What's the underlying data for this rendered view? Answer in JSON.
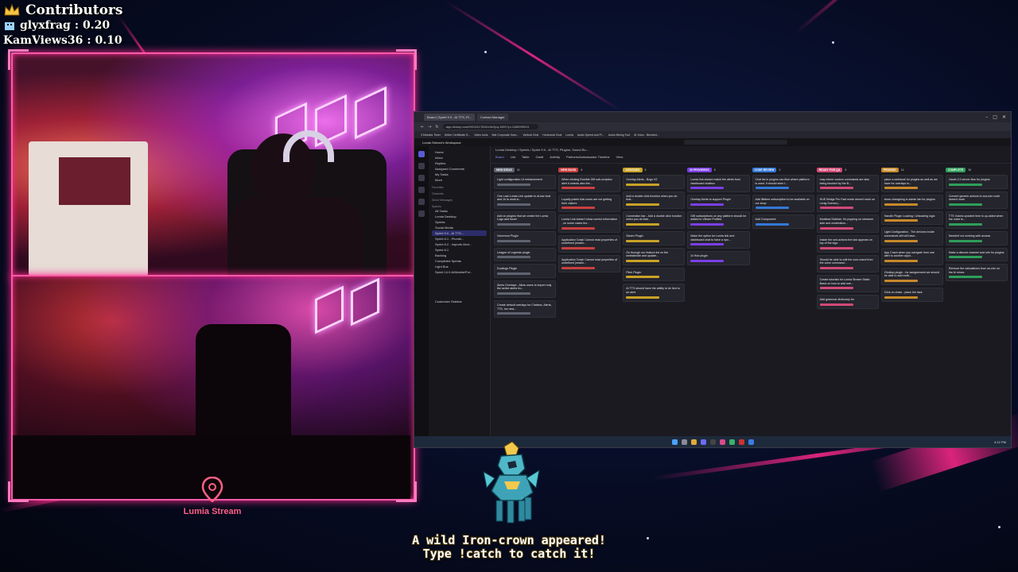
{
  "contributors": {
    "title": "Contributors",
    "entries": [
      {
        "name": "glyxfrag",
        "value": "0.20"
      },
      {
        "name": "KamViews36",
        "value": "0.10"
      }
    ]
  },
  "logo": {
    "name": "Lumia Stream"
  },
  "catch_message": {
    "line1": "A wild Iron-crown appeared!",
    "line2": "Type !catch to catch it!"
  },
  "screen_share": {
    "browser_tabs": [
      "Board | Sprint 9.0 - AI TTS, Pl...",
      "Contact Manager"
    ],
    "url": "app.clickup.com/9012417816/v/b/2pq-1801?p=1188939011",
    "bookmarks": [
      "3 Minutes Timer",
      "Dirtier Certificate S...",
      "Video tools",
      "Mat Corporate Gam...",
      "Vertical Chat",
      "Horizontal Chat",
      "Lumia",
      "Audio Speed and Pi...",
      "Audio Mixing Tool",
      "AI Voice - Blended..."
    ],
    "workspace": "Lumia Stream's Workspace",
    "breadcrumb": "Lumia Desktop / Sprints / Sprint 9.0 - AI TTS, Plugins, Sound Bo...",
    "views": [
      "Board",
      "List",
      "Table",
      "Gantt",
      "Activity",
      "Partners/Ambassador Timeline",
      "View"
    ],
    "sidebar": {
      "items": [
        "Home",
        "Inbox",
        "Replies",
        "Assigned Comments",
        "My Tasks",
        "More"
      ],
      "sections": [
        "Favorites",
        "Channels",
        "Direct Messages",
        "Spaces"
      ],
      "spaces": [
        "All Tasks",
        "Lumia Desktop",
        "Sprints",
        "Social Media",
        "Sprint 9.0 - AI TTS...",
        "Sprint 8.1 - Plumbi...",
        "Sprint 8.2 - Imports Mod...",
        "Sprint 8.1",
        "Backlog",
        "Completed Sprints",
        "Light Bus",
        "Sprint 14.0 AI/Mobile/Pol..."
      ],
      "customize": "Customize Sidebar"
    },
    "columns": [
      {
        "name": "NEW IDEAS",
        "count": "21",
        "color": "#5f6370",
        "cards": [
          "Light configuration UI enhancement",
          "One Last Lumia Link update to al-low chat and 1h to work in...",
          "Add on plugins that we create the Lumia Logo and hover",
          "Voicemod Plugin",
          "League of Legends plugin",
          "Duolingo Plugin",
          "Alerts Overlays - Allow users to import only the active alerts fro...",
          "Create default overlays for Chatbox, Alerts, TTS, Ice new..."
        ]
      },
      {
        "name": "NEW BUGS",
        "count": "6",
        "color": "#c94040",
        "cards": [
          "When clicking Rumble Gift sub-scription alert it selects also the...",
          "Loyalty points kick users are not getting their visitors",
          "Lumia Link doesn't show correct information , on some cases the...",
          "Application Crash Cannot read properties of undefined (readin...",
          "Application Crash Cannot read properties of undefined (readin..."
        ]
      },
      {
        "name": "ASSIGNED",
        "count": "6",
        "color": "#c9a227",
        "cards": [
          "Overlay Alerts - Bugs V2",
          "Add a double click function when you do that...",
          "Connection bar - Add a double click function when you do that...",
          "Steam Plugin",
          "Go through our feature list on the website/site and update...",
          "Pitch Plugin",
          "AI TTS should have the ability to be tied to an alert"
        ]
      },
      {
        "name": "IN PROGRESS",
        "count": "6",
        "color": "#7b3fe4",
        "cards": [
          "Lumia link doesnt match the alerts from dashboard chatbox",
          "Overlay Alerts to support Plugin",
          "Gift subscriptions on any platform should be added to Viewer Profiles",
          "Make the option for Lumia link and dashboard chat to have a npo...",
          "AI Hub plugin"
        ]
      },
      {
        "name": "CODE REVIEW",
        "count": "2",
        "color": "#3478d6",
        "cards": [
          "Chat list in plugins can flow where platform is used. It should seen t...",
          "Add lifetime subscription to be available on our shop",
          "Add Component"
        ]
      },
      {
        "name": "READY FOR QA",
        "count": "9",
        "color": "#d24a76",
        "cards": [
          "may where custom commands are also being blocked by the B...",
          "HUE Bridge Pro Fast mode doesn't work on Lenig Scenes |...",
          "Modlead Sidebar: It's popping on streamer side and moderation...",
          "Inside the sml-actions the last appears on top of the logo",
          "Should be able to edit the com-mand from the voice command...",
          "Create tutorials for Lumia Stream Static Basic on how to add one...",
          "Add grammar dictionary for"
        ]
      },
      {
        "name": "PENDING",
        "count": "14",
        "color": "#c78a2a",
        "cards": [
          "place a webhook for plugins as well as we have for overlays in...",
          "show changelog in admin tab for plugins",
          "Handle Plugin Loading / Unloading logic",
          "Light Configuration - The devices inside commands still will have...",
          "App Crash when you navigate from one alert to another appli...",
          "Clicktop plugin - for assignement we should be able to add multi...",
          "Click on chats - place the task"
        ]
      },
      {
        "name": "COMPLETE",
        "count": "30",
        "color": "#2f9e5a",
        "cards": [
          "Oauth 2.0 server flow for plugins",
          "Convert generic actions to cus-tom code doesn't work",
          "TTS Voices updated time is up-dated when the voice is...",
          "Newrlerf not working with access",
          "Make a discord channel and role for plugins",
          "Remove the calculations from an-min on the AI mixes"
        ]
      }
    ],
    "clock": "4:12 PM"
  },
  "colors": {
    "accent_pink": "#ff2d8e",
    "logo_pink": "#ff5f85",
    "background": "#070c24"
  }
}
